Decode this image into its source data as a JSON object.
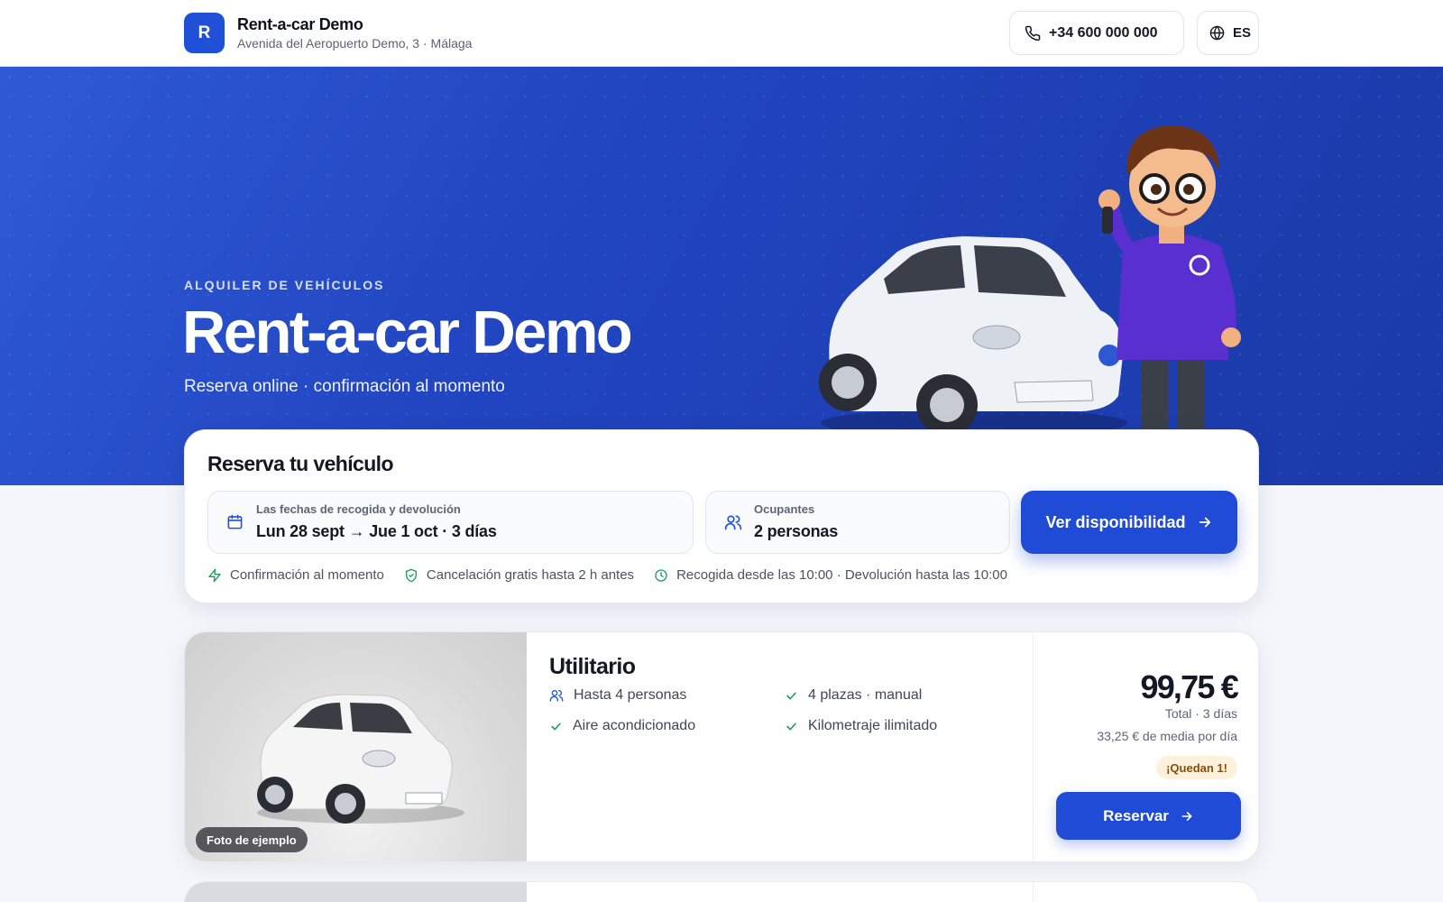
{
  "header": {
    "logo_letter": "R",
    "brand_name": "Rent-a-car Demo",
    "address": "Avenida del Aeropuerto Demo, 3 · Málaga",
    "phone": "+34 600 000 000",
    "language": "ES"
  },
  "hero": {
    "eyebrow": "ALQUILER DE VEHÍCULOS",
    "title": "Rent-a-car Demo",
    "subtitle": "Reserva online · confirmación al momento"
  },
  "booking": {
    "title": "Reserva tu vehículo",
    "dates_label": "Las fechas de recogida y devolución",
    "dates_value": "Lun 28 sept → Jue 1 oct · 3 días",
    "occupants_label": "Ocupantes",
    "occupants_value": "2 personas",
    "cta_label": "Ver disponibilidad",
    "perks": [
      "Confirmación al momento",
      "Cancelación gratis hasta 2 h antes",
      "Recogida desde las 10:00 · Devolución hasta las 10:00"
    ]
  },
  "vehicles": [
    {
      "photo_tag": "Foto de ejemplo",
      "name": "Utilitario",
      "features": [
        "Hasta 4 personas",
        "4 plazas · manual",
        "Aire acondicionado",
        "Kilometraje ilimitado"
      ],
      "price": "99,75 €",
      "total_label": "Total · 3 días",
      "avg_label": "33,25 € de media por día",
      "badge": "¡Quedan 1!",
      "reserve_label": "Reservar"
    }
  ],
  "colors": {
    "primary": "#1f4bd6",
    "hero": "#2144c0",
    "success": "#1f9a5b",
    "badge_bg": "#fdf1dc",
    "badge_text": "#8a4e06"
  },
  "icons": [
    "phone-icon",
    "globe-icon",
    "calendar-icon",
    "users-icon",
    "arrow-right-icon",
    "bolt-icon",
    "shield-check-icon",
    "clock-icon",
    "check-icon"
  ]
}
